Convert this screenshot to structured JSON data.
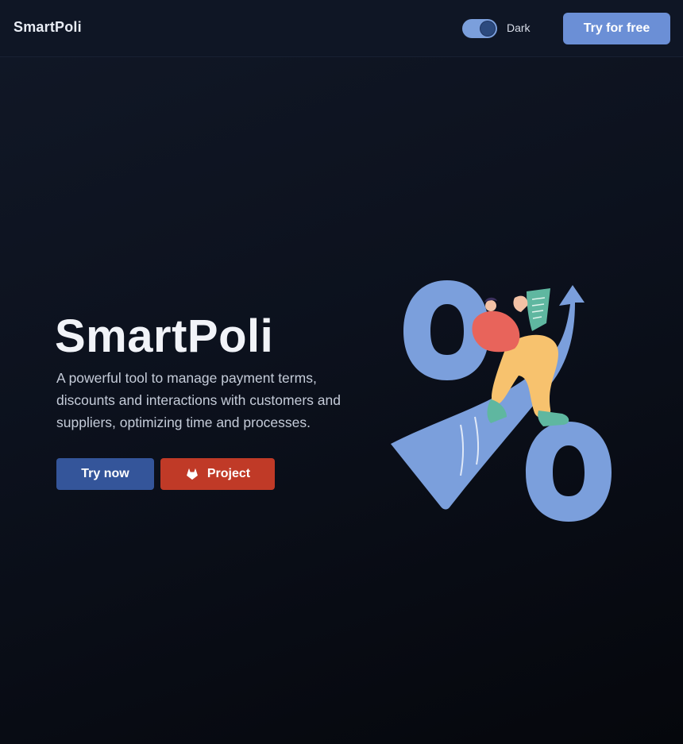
{
  "navbar": {
    "brand": "SmartPoli",
    "theme_toggle": {
      "label": "Dark",
      "checked": true
    },
    "cta_label": "Try for free"
  },
  "hero": {
    "title": "SmartPoli",
    "description": "A powerful tool to manage payment terms, discounts and interactions with customers and suppliers, optimizing time and processes.",
    "primary_button": "Try now",
    "secondary_button": "Project",
    "secondary_button_icon": "gitlab-icon",
    "illustration_icon": "percent-growth-illustration"
  },
  "colors": {
    "background": "#0c111d",
    "navbar": "#0f1625",
    "accent": "#6b8fd6",
    "primary_button": "#34559a",
    "project_button": "#c03a27"
  }
}
